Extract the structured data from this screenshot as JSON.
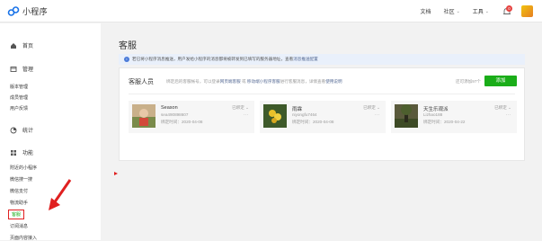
{
  "app": {
    "title": "小程序"
  },
  "topnav": {
    "docs": "文档",
    "community": "社区",
    "tools": "工具",
    "notify_count": "0"
  },
  "sidebar": {
    "home": "首页",
    "manage": {
      "label": "管理",
      "items": [
        "版本管理",
        "成员管理",
        "用户反馈"
      ]
    },
    "stats": "统计",
    "features": {
      "label": "功能",
      "items": [
        "附近的小程序",
        "微信搜一搜",
        "微信支付",
        "物流助手",
        "客服",
        "订阅消息",
        "页面内容接入"
      ]
    }
  },
  "main": {
    "title": "客服",
    "notice": {
      "text": "若已将小程序消息推送，用户发给小程序的消息都将被转发到已填写的服务器地址，查看",
      "link": "消息推送配置"
    },
    "panel": {
      "title": "客服人员",
      "desc_prefix": "绑定后的客服帐号，可以登录",
      "desc_link1": "网页端客服",
      "desc_mid": "或",
      "desc_link2": "移动端小程序客服",
      "desc_suffix": "进行客服消息，详情查看",
      "desc_link3": "使用说明",
      "quota": "还可添加97个",
      "add_button": "添加"
    },
    "agents": [
      {
        "name": "Season",
        "wechat": "sea490898607",
        "time": "绑定时间：2020-04-08",
        "status": "已绑定 ⌄"
      },
      {
        "name": "雨霖",
        "wechat": "niyongfu7464",
        "time": "绑定时间：2020-04-08",
        "status": "已绑定 ⌄"
      },
      {
        "name": "天生乐观派",
        "wechat": "Lizhao188",
        "time": "绑定时间：2020-04-22",
        "status": "已绑定 ⌄"
      }
    ],
    "more_glyph": "···"
  },
  "colors": {
    "accent": "#1aad19",
    "link": "#576b95",
    "annotation": "#e02020"
  }
}
